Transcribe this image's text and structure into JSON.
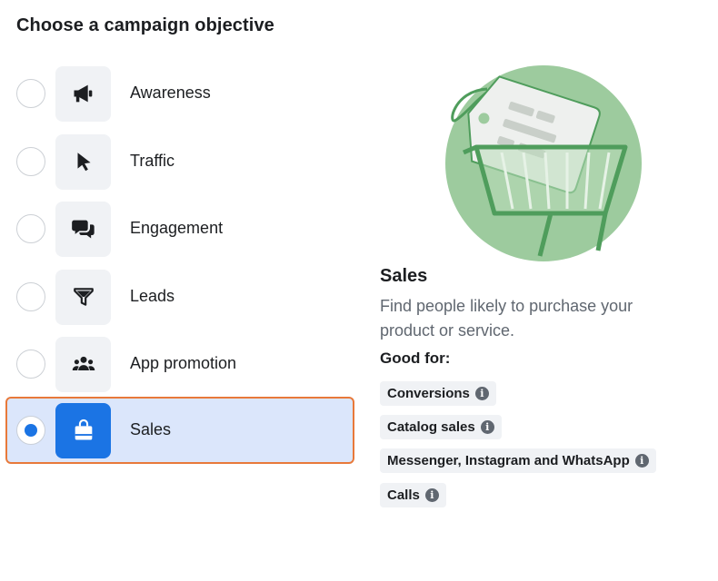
{
  "header": {
    "title": "Choose a campaign objective"
  },
  "objectives": [
    {
      "label": "Awareness",
      "icon": "megaphone-icon"
    },
    {
      "label": "Traffic",
      "icon": "cursor-icon"
    },
    {
      "label": "Engagement",
      "icon": "chat-bubbles-icon"
    },
    {
      "label": "Leads",
      "icon": "funnel-icon"
    },
    {
      "label": "App promotion",
      "icon": "people-icon"
    },
    {
      "label": "Sales",
      "icon": "shopping-bag-icon",
      "selected": true
    }
  ],
  "detail": {
    "title": "Sales",
    "description": "Find people likely to purchase your product or service.",
    "good_for_label": "Good for:",
    "tags": [
      {
        "label": "Conversions"
      },
      {
        "label": "Catalog sales"
      },
      {
        "label": "Messenger, Instagram and WhatsApp"
      },
      {
        "label": "Calls"
      }
    ],
    "info_glyph": "i"
  },
  "colors": {
    "accent": "#1b74e4",
    "selected_bg": "#dbe6fb",
    "selected_border": "#e8793a",
    "icon_bg": "#f0f2f5",
    "illustration_green": "#9dcb9e"
  }
}
